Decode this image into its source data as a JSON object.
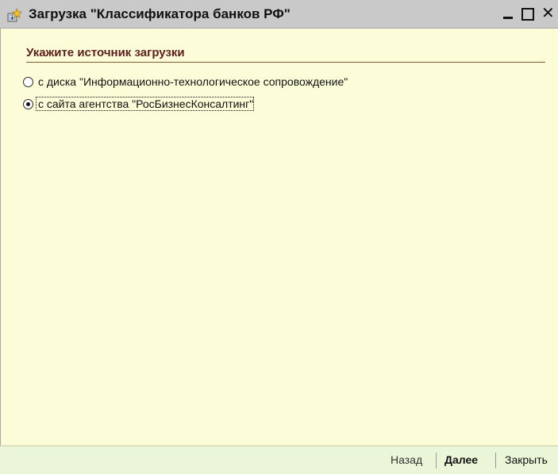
{
  "window": {
    "title": "Загрузка \"Классификатора банков РФ\"",
    "icon": "download-wizard-icon",
    "minimize_icon": "minimize-icon",
    "maximize_icon": "maximize-icon",
    "close_icon": "close-icon",
    "close_glyph": "✕"
  },
  "section": {
    "title": "Укажите источник загрузки"
  },
  "sources": [
    {
      "label": "с диска \"Информационно-технологическое сопровождение\"",
      "selected": false
    },
    {
      "label": "с сайта агентства \"РосБизнесКонсалтинг\"",
      "selected": true
    }
  ],
  "footer": {
    "back_label": "Назад",
    "next_label": "Далее",
    "close_label": "Закрыть"
  },
  "colors": {
    "background": "#fdfcd8",
    "titlebar": "#c9c9c9",
    "section_title": "#5a1f1f",
    "footer": "#ebf5d8"
  }
}
